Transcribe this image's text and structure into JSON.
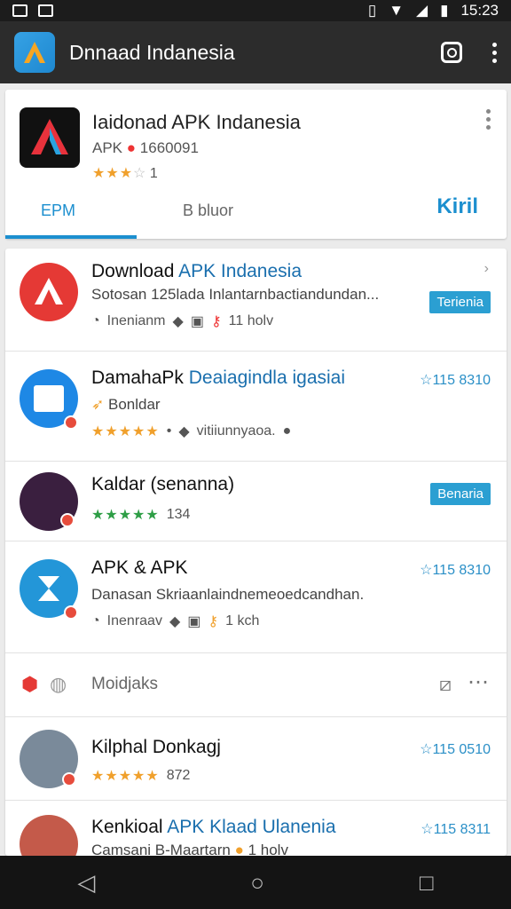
{
  "status": {
    "time": "15:23"
  },
  "appbar": {
    "title": "Dnnaad Indanesia"
  },
  "header": {
    "name": "Iaidonad APK Indanesia",
    "sub_prefix": "APK",
    "sub_code": "1660091",
    "rating_count": "1",
    "tabs": [
      "EPM",
      "B bluor",
      "Kiril"
    ]
  },
  "rows": [
    {
      "title_a": "Download ",
      "title_b": "APK Indanesia",
      "line": "Sotosan 125lada Inlantarnbactiandundan...",
      "meta": [
        "Inenianm",
        "11 holv"
      ],
      "button": "Terienia"
    },
    {
      "title_a": "DamahaPk ",
      "title_b": "Deaiagindla igasiai",
      "line": "Bonldar",
      "meta": [
        "vitiiunnyaoa."
      ],
      "right": "115 8310"
    },
    {
      "title_a": "Kaldar (senanna)",
      "title_b": "",
      "meta": [
        "134"
      ],
      "button": "Benaria"
    },
    {
      "title_a": "APK & APK",
      "title_b": "",
      "line": "Danasan Skriaanlaindnemeoedcandhan.",
      "meta": [
        "Inenraav",
        "1 kch"
      ],
      "right": "115 8310"
    },
    {
      "title_a": "Moidjaks",
      "title_b": ""
    },
    {
      "title_a": "Kilphal Donkagj",
      "title_b": "",
      "meta": [
        "872"
      ],
      "right": "115 0510"
    },
    {
      "title_a": "Kenkioal ",
      "title_b": "APK Klaad Ulanenia",
      "line": "Camsani B-Maartarn",
      "meta": [
        "1 holv"
      ],
      "right": "115 8311"
    }
  ],
  "colors": {
    "accent": "#1c8fcf",
    "star": "#f0a02c",
    "button": "#2b9fd2"
  },
  "icons": [
    "wifi-icon",
    "signal-icon",
    "battery-icon",
    "camera-icon",
    "more-vert-icon",
    "back-icon",
    "home-icon",
    "recents-icon"
  ]
}
